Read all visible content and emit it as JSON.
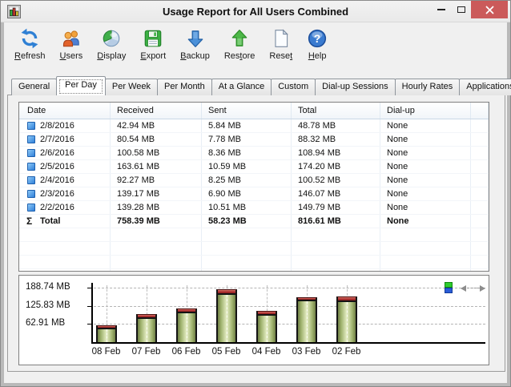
{
  "window": {
    "title": "Usage Report for All Users Combined"
  },
  "toolbar": {
    "items": [
      {
        "id": "refresh",
        "prefix": "",
        "hotkey": "R",
        "suffix": "efresh"
      },
      {
        "id": "users",
        "prefix": "",
        "hotkey": "U",
        "suffix": "sers"
      },
      {
        "id": "display",
        "prefix": "",
        "hotkey": "D",
        "suffix": "isplay"
      },
      {
        "id": "export",
        "prefix": "",
        "hotkey": "E",
        "suffix": "xport"
      },
      {
        "id": "backup",
        "prefix": "",
        "hotkey": "B",
        "suffix": "ackup"
      },
      {
        "id": "restore",
        "prefix": "Res",
        "hotkey": "t",
        "suffix": "ore"
      },
      {
        "id": "reset",
        "prefix": "Rese",
        "hotkey": "t",
        "suffix": ""
      },
      {
        "id": "help",
        "prefix": "",
        "hotkey": "H",
        "suffix": "elp"
      }
    ]
  },
  "tabs": {
    "selected": "Per Day",
    "items": [
      {
        "label": "General",
        "selected": false
      },
      {
        "label": "Per Day",
        "selected": true
      },
      {
        "label": "Per Week",
        "selected": false
      },
      {
        "label": "Per Month",
        "selected": false
      },
      {
        "label": "At a Glance",
        "selected": false
      },
      {
        "label": "Custom",
        "selected": false
      },
      {
        "label": "Dial-up Sessions",
        "selected": false
      },
      {
        "label": "Hourly Rates",
        "selected": false
      },
      {
        "label": "Applications",
        "selected": false
      }
    ]
  },
  "table": {
    "columns": [
      "Date",
      "Received",
      "Sent",
      "Total",
      "Dial-up"
    ],
    "rows": [
      {
        "date": "2/8/2016",
        "received": "42.94 MB",
        "sent": "5.84 MB",
        "total": "48.78 MB",
        "dialup": "None"
      },
      {
        "date": "2/7/2016",
        "received": "80.54 MB",
        "sent": "7.78 MB",
        "total": "88.32 MB",
        "dialup": "None"
      },
      {
        "date": "2/6/2016",
        "received": "100.58 MB",
        "sent": "8.36 MB",
        "total": "108.94 MB",
        "dialup": "None"
      },
      {
        "date": "2/5/2016",
        "received": "163.61 MB",
        "sent": "10.59 MB",
        "total": "174.20 MB",
        "dialup": "None"
      },
      {
        "date": "2/4/2016",
        "received": "92.27 MB",
        "sent": "8.25 MB",
        "total": "100.52 MB",
        "dialup": "None"
      },
      {
        "date": "2/3/2016",
        "received": "139.17 MB",
        "sent": "6.90 MB",
        "total": "146.07 MB",
        "dialup": "None"
      },
      {
        "date": "2/2/2016",
        "received": "139.28 MB",
        "sent": "10.51 MB",
        "total": "149.79 MB",
        "dialup": "None"
      }
    ],
    "total_row": {
      "date": "Total",
      "received": "758.39 MB",
      "sent": "58.23 MB",
      "total": "816.61 MB",
      "dialup": "None"
    }
  },
  "chart_data": {
    "type": "bar",
    "stacked": true,
    "categories": [
      "08 Feb",
      "07 Feb",
      "06 Feb",
      "05 Feb",
      "04 Feb",
      "03 Feb",
      "02 Feb"
    ],
    "series": [
      {
        "name": "Received",
        "color": "#9fb26d",
        "values": [
          42.94,
          80.54,
          100.58,
          163.61,
          92.27,
          139.17,
          139.28
        ]
      },
      {
        "name": "Sent",
        "color": "#b03434",
        "values": [
          5.84,
          7.78,
          8.36,
          10.59,
          8.25,
          6.9,
          10.51
        ]
      }
    ],
    "totals": [
      48.78,
      88.32,
      108.94,
      174.2,
      100.52,
      146.07,
      149.79
    ],
    "unit": "MB",
    "yticks": [
      {
        "value": 188.74,
        "label": "188.74 MB"
      },
      {
        "value": 125.83,
        "label": "125.83 MB"
      },
      {
        "value": 62.91,
        "label": "62.91 MB"
      }
    ],
    "ylim": [
      0,
      205
    ],
    "grid": "dashed",
    "legend_position": "top-right"
  },
  "colors": {
    "close_button": "#cb5a5a",
    "bar_received": "#9fb26d",
    "bar_sent": "#b03434",
    "legend_received": "#2ecc2e",
    "legend_sent": "#2a5cd6",
    "row_icon": "#3a86dd"
  }
}
